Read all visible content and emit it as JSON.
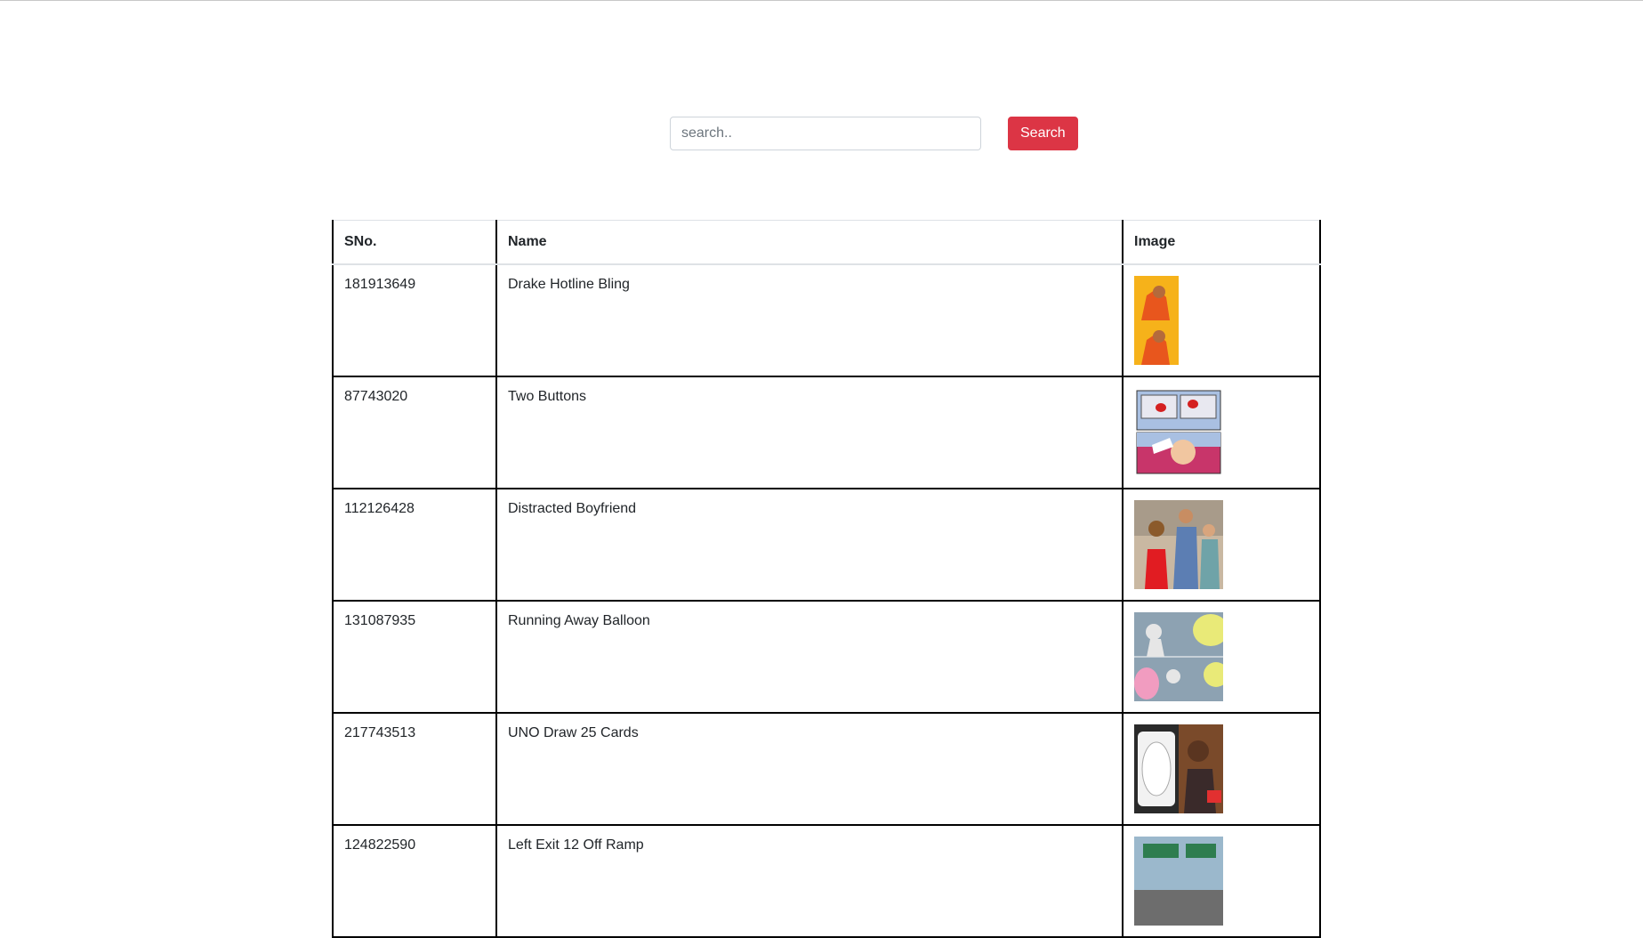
{
  "search": {
    "placeholder": "search..",
    "value": "",
    "button_label": "Search",
    "button_color": "#dc3545"
  },
  "table": {
    "headers": [
      "SNo.",
      "Name",
      "Image"
    ],
    "rows": [
      {
        "sno": "181913649",
        "name": "Drake Hotline Bling",
        "image": "drake-hotline-bling-thumbnail"
      },
      {
        "sno": "87743020",
        "name": "Two Buttons",
        "image": "two-buttons-thumbnail"
      },
      {
        "sno": "112126428",
        "name": "Distracted Boyfriend",
        "image": "distracted-boyfriend-thumbnail"
      },
      {
        "sno": "131087935",
        "name": "Running Away Balloon",
        "image": "running-away-balloon-thumbnail"
      },
      {
        "sno": "217743513",
        "name": "UNO Draw 25 Cards",
        "image": "uno-draw-25-cards-thumbnail"
      },
      {
        "sno": "124822590",
        "name": "Left Exit 12 Off Ramp",
        "image": "left-exit-12-off-ramp-thumbnail"
      }
    ]
  }
}
